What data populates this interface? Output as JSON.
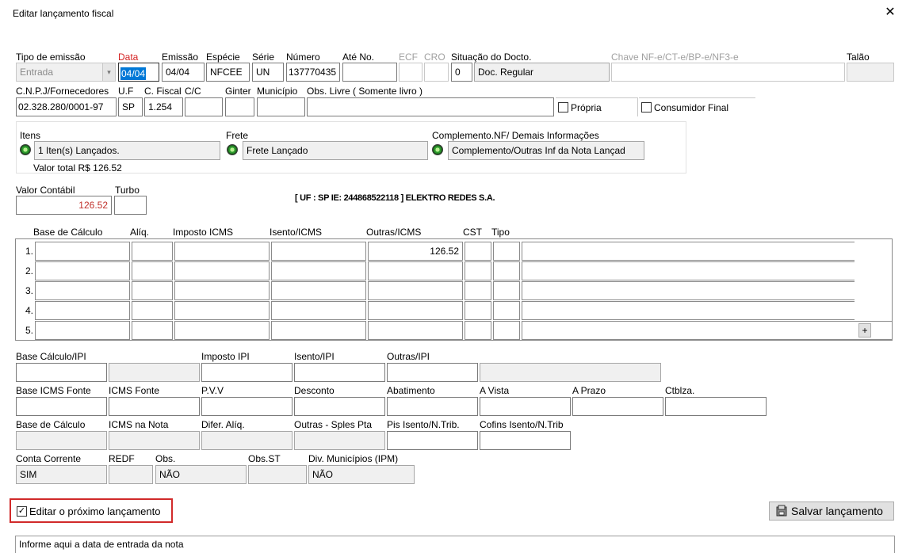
{
  "window": {
    "title": "Editar lançamento fiscal"
  },
  "header_fields": {
    "tipo_emissao": {
      "label": "Tipo de emissão",
      "value": "Entrada"
    },
    "data": {
      "label": "Data",
      "value": "04/04"
    },
    "emissao": {
      "label": "Emissão",
      "value": "04/04"
    },
    "especie": {
      "label": "Espécie",
      "value": "NFCEE"
    },
    "serie": {
      "label": "Série",
      "value": "UN"
    },
    "numero": {
      "label": "Número",
      "value": "137770435"
    },
    "ate_no": {
      "label": "Até No.",
      "value": ""
    },
    "ecf": {
      "label": "ECF",
      "value": ""
    },
    "cro": {
      "label": "CRO",
      "value": ""
    },
    "situacao": {
      "label": "Situação do Docto.",
      "code": "0",
      "value": "Doc. Regular"
    },
    "chave": {
      "label": "Chave NF-e/CT-e/BP-e/NF3-e",
      "value": ""
    },
    "talao": {
      "label": "Talão",
      "value": ""
    }
  },
  "row2": {
    "cnpj": {
      "label": "C.N.P.J/Fornecedores",
      "value": "02.328.280/0001-97"
    },
    "uf": {
      "label": "U.F",
      "value": "SP"
    },
    "cfiscal": {
      "label": "C. Fiscal",
      "value": "1.254"
    },
    "cc": {
      "label": "C/C",
      "value": ""
    },
    "ginter": {
      "label": "Ginter",
      "value": ""
    },
    "municipio": {
      "label": "Município",
      "value": ""
    },
    "obs_livre": {
      "label": "Obs. Livre ( Somente livro )",
      "value": ""
    },
    "propria": {
      "label": "Própria",
      "checked": false
    },
    "consumidor_final": {
      "label": "Consumidor Final",
      "checked": false
    }
  },
  "summary": {
    "itens": {
      "label": "Itens",
      "value": "1 Iten(s) Lançados."
    },
    "frete": {
      "label": "Frete",
      "value": "Frete Lançado"
    },
    "complemento": {
      "label": "Complemento.NF/ Demais Informações",
      "value": "Complemento/Outras Inf da Nota Lançad"
    },
    "valor_total": "Valor total R$ 126.52"
  },
  "valor": {
    "contabil": {
      "label": "Valor Contábil",
      "value": "126.52"
    },
    "turbo": {
      "label": "Turbo",
      "value": ""
    },
    "supplier_info": "[ UF : SP IE: 244868522118 ] ELEKTRO REDES S.A."
  },
  "icms_grid": {
    "headers": [
      "Base de Cálculo",
      "Alíq.",
      "Imposto ICMS",
      "Isento/ICMS",
      "Outras/ICMS",
      "CST",
      "Tipo"
    ],
    "rows": [
      {
        "num": "1.",
        "outras": "126.52"
      },
      {
        "num": "2.",
        "outras": ""
      },
      {
        "num": "3.",
        "outras": ""
      },
      {
        "num": "4.",
        "outras": ""
      },
      {
        "num": "5.",
        "outras": ""
      }
    ],
    "plus_label": "+"
  },
  "ipi": {
    "base_calculo": {
      "label": "Base Cálculo/IPI",
      "value": ""
    },
    "imposto": {
      "label": "Imposto IPI",
      "value": ""
    },
    "isento": {
      "label": "Isento/IPI",
      "value": ""
    },
    "outras": {
      "label": "Outras/IPI",
      "value": ""
    }
  },
  "fonte": {
    "base_icms_fonte": {
      "label": "Base ICMS Fonte",
      "value": ""
    },
    "icms_fonte": {
      "label": "ICMS Fonte",
      "value": ""
    },
    "pvv": {
      "label": "P.V.V",
      "value": ""
    },
    "desconto": {
      "label": "Desconto",
      "value": ""
    },
    "abatimento": {
      "label": "Abatimento",
      "value": ""
    },
    "a_vista": {
      "label": "A Vista",
      "value": ""
    },
    "a_prazo": {
      "label": "A Prazo",
      "value": ""
    },
    "ctblza": {
      "label": "Ctblza.",
      "value": ""
    }
  },
  "calc": {
    "base_calculo": {
      "label": "Base de Cálculo",
      "value": ""
    },
    "icms_na_nota": {
      "label": "ICMS na Nota",
      "value": ""
    },
    "difer_aliq": {
      "label": "Difer. Alíq.",
      "value": ""
    },
    "outras_sples": {
      "label": "Outras - Sples Pta",
      "value": ""
    },
    "pis_isento": {
      "label": "Pis Isento/N.Trib.",
      "value": ""
    },
    "cofins_isento": {
      "label": "Cofins Isento/N.Trib",
      "value": ""
    }
  },
  "extra": {
    "conta_corrente": {
      "label": "Conta Corrente",
      "value": "SIM"
    },
    "redf": {
      "label": "REDF",
      "value": ""
    },
    "obs": {
      "label": "Obs.",
      "value": "NÃO"
    },
    "obs_st": {
      "label": "Obs.ST",
      "value": ""
    },
    "div_municipios": {
      "label": "Div. Municípios (IPM)",
      "value": "NÃO"
    }
  },
  "footer": {
    "editar_proximo": {
      "label": "Editar o próximo lançamento",
      "checked": true
    },
    "salvar_label": "Salvar lançamento",
    "status_text": "Informe aqui a data de entrada da nota"
  },
  "colors": {
    "highlight": "#d12a2a",
    "data_label": "#d42020",
    "selected_bg": "#0078d7"
  }
}
